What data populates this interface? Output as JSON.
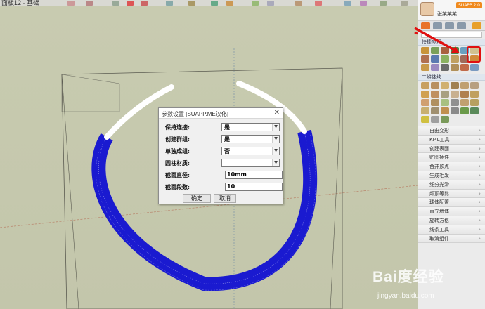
{
  "toolbar": {
    "partial_text": "面板12 · 基础"
  },
  "dialog": {
    "title": "参数设置 [SUAPP.ME汉化]",
    "rows": [
      {
        "label": "保持连接:",
        "kind": "select",
        "value": "是"
      },
      {
        "label": "创建群组:",
        "kind": "select",
        "value": "是"
      },
      {
        "label": "单独成组:",
        "kind": "select",
        "value": "否"
      },
      {
        "label": "圆柱材质:",
        "kind": "select",
        "value": ""
      },
      {
        "label": "截面直径:",
        "kind": "input",
        "value": "10mm"
      },
      {
        "label": "截面段数:",
        "kind": "input",
        "value": "10"
      }
    ],
    "ok_label": "确定",
    "cancel_label": "取消"
  },
  "panel": {
    "user_name": "张某某某",
    "badge": "SUAPP 2.0",
    "section_quick": "快捷应用",
    "section_3d": "三维体块",
    "menu": [
      "自由变形",
      "KML工具",
      "创建表面",
      "贴图插件",
      "合并顶点",
      "生成毛发",
      "细分光滑",
      "颅顶等比",
      "球体配置",
      "直立墙体",
      "旋转方格",
      "线条工具",
      "取消组件"
    ]
  },
  "watermark": {
    "brand": "Bai度经验",
    "url": "jingyan.baidu.com"
  },
  "colors": {
    "ring": "#1a1ad0",
    "ring_highlight": "#ffffff",
    "annotation": "#e01010",
    "viewport": "#c8cbb0"
  }
}
